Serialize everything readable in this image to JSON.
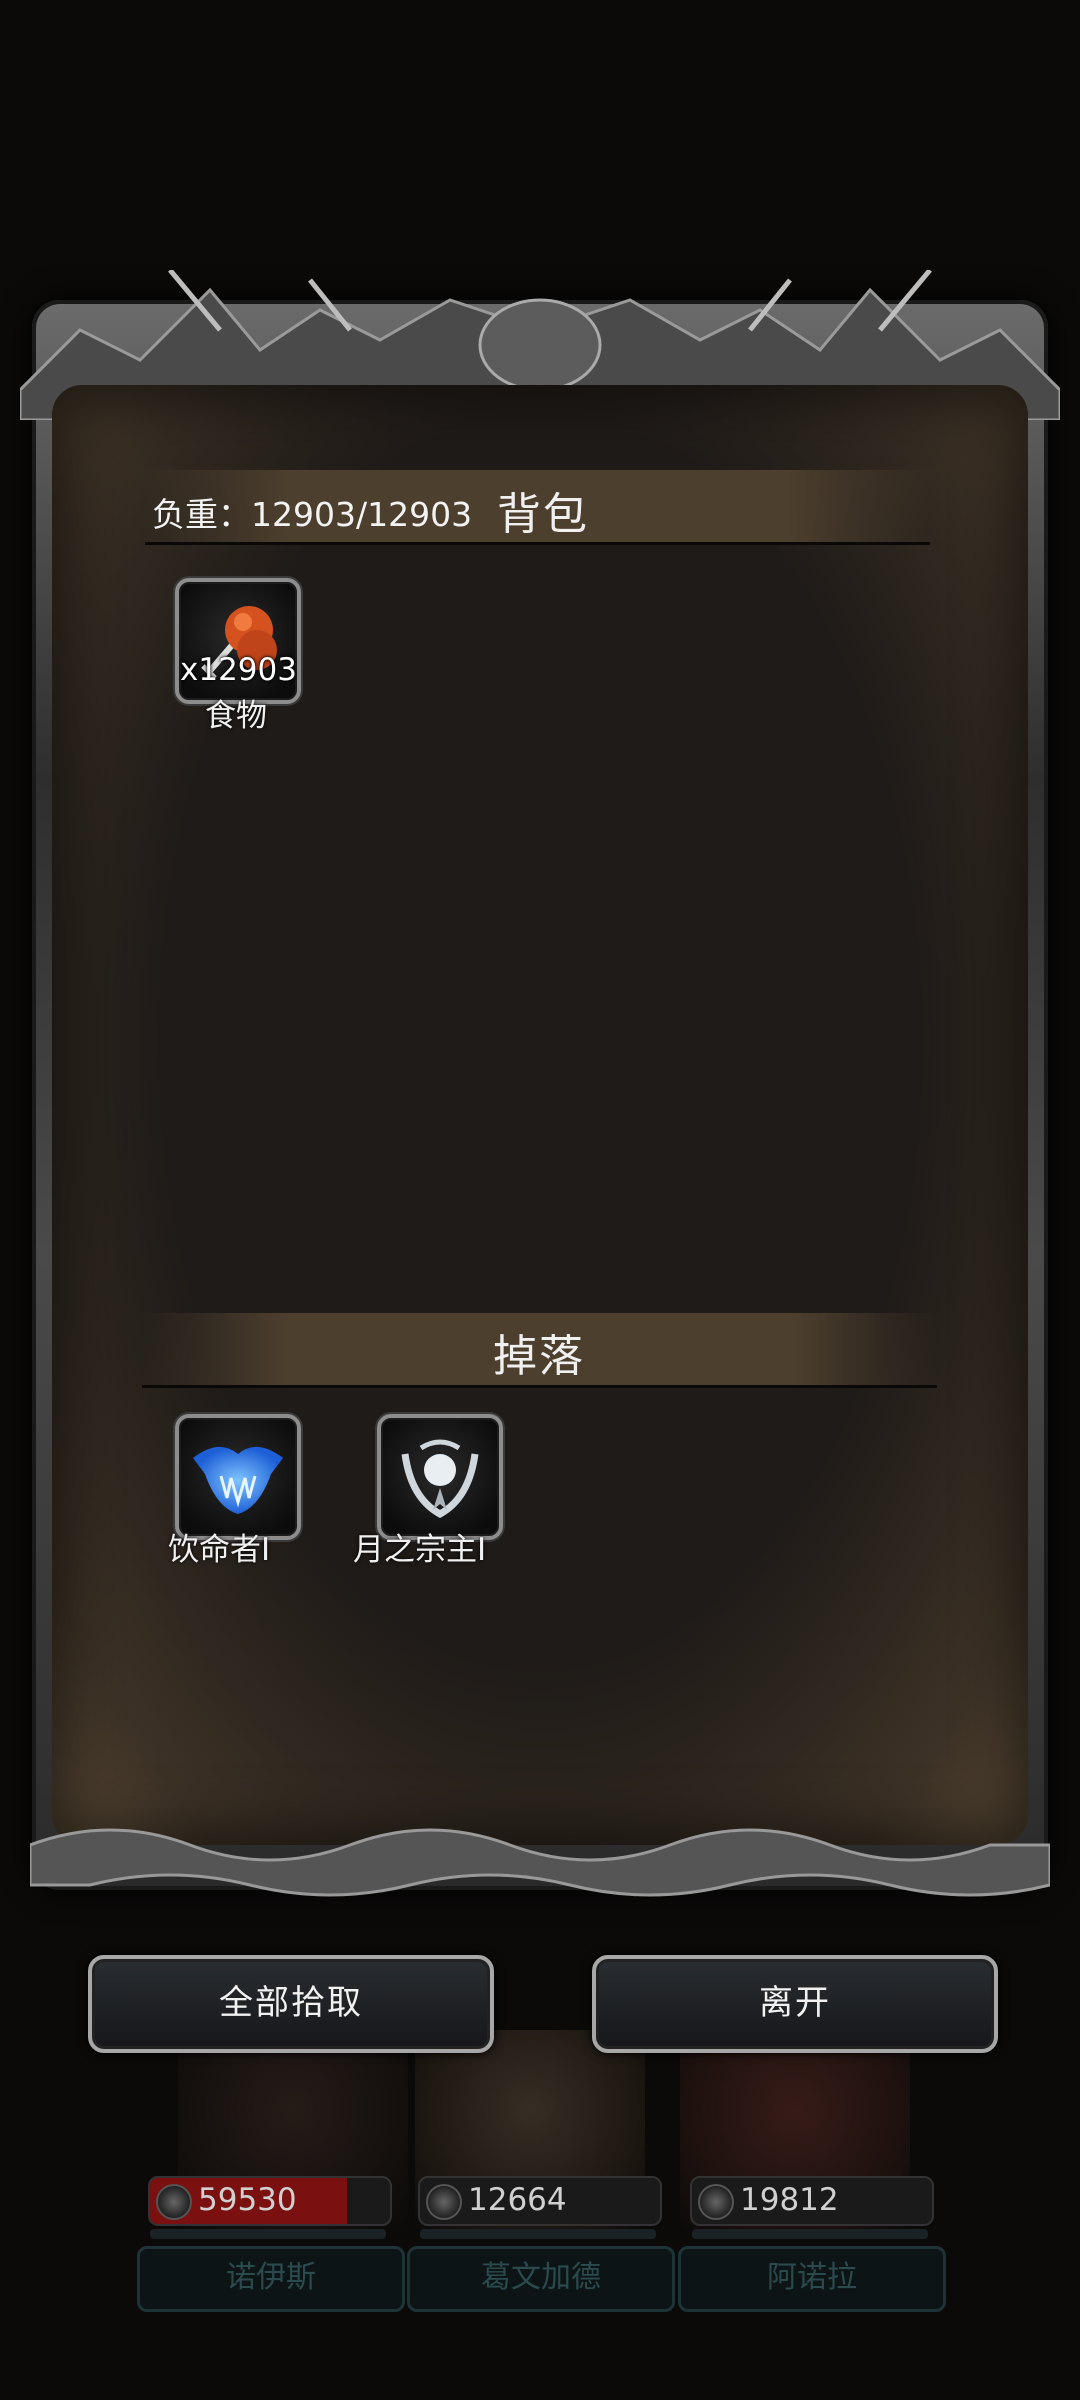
{
  "bag": {
    "weight_label": "负重：12903/12903",
    "title": "背包",
    "items": [
      {
        "name": "食物",
        "quantity": "x12903",
        "icon": "roast-meat-icon"
      }
    ]
  },
  "drops": {
    "title": "掉落",
    "items": [
      {
        "name": "饮命者Ⅰ",
        "icon": "blue-fang-emblem-icon"
      },
      {
        "name": "月之宗主Ⅰ",
        "icon": "silver-moon-emblem-icon"
      }
    ]
  },
  "buttons": {
    "pickup_all": "全部拾取",
    "leave": "离开"
  },
  "heroes": [
    {
      "name": "诺伊斯",
      "hp": "59530",
      "hp_fraction": 0.82
    },
    {
      "name": "葛文加德",
      "hp": "12664",
      "hp_fraction": 0.0
    },
    {
      "name": "阿诺拉",
      "hp": "19812",
      "hp_fraction": 0.0
    }
  ],
  "colors": {
    "panel_bg": "#1f1b18",
    "header_bg": "#4d3f2e",
    "hp_fill": "#7a1010",
    "name_plate_text": "#2a4a4e"
  }
}
